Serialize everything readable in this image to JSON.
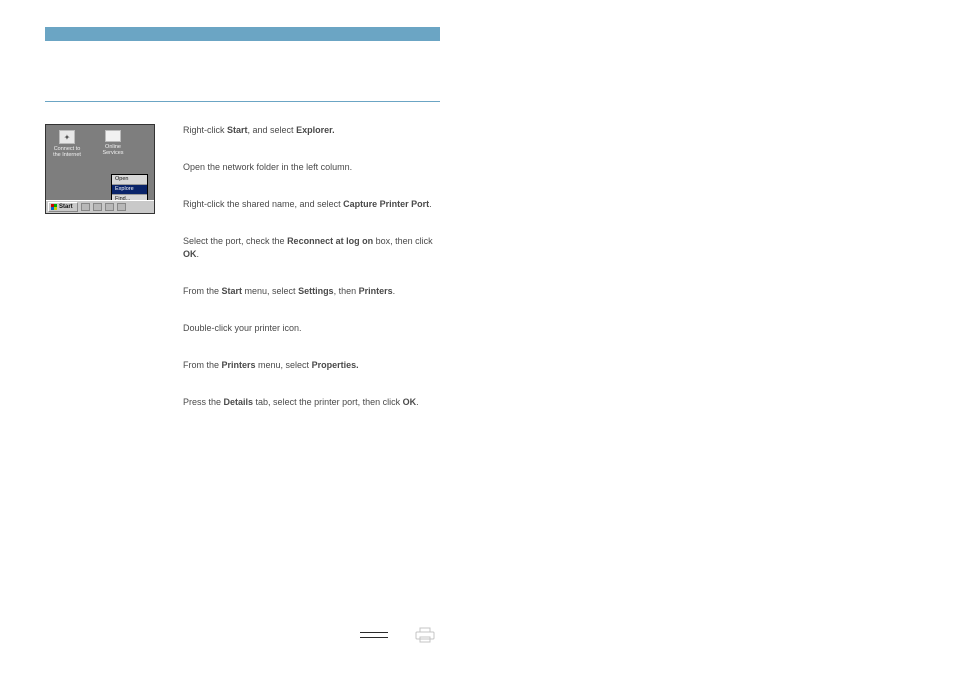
{
  "screenshot": {
    "icons": [
      {
        "name": "connect-internet",
        "label": "Connect to the\nInternet"
      },
      {
        "name": "online-services",
        "label": "Online\nServices"
      }
    ],
    "context_menu": [
      "Open",
      "Explore",
      "Find..."
    ],
    "start_label": "Start"
  },
  "steps": [
    {
      "parts": [
        {
          "t": "Right-click "
        },
        {
          "t": "Start",
          "b": true
        },
        {
          "t": ", and select "
        },
        {
          "t": "Explorer.",
          "b": true
        }
      ]
    },
    {
      "parts": [
        {
          "t": "Open the network folder in the left column."
        }
      ]
    },
    {
      "parts": [
        {
          "t": "Right-click the shared name, and select "
        },
        {
          "t": "Capture Printer Port",
          "b": true
        },
        {
          "t": "."
        }
      ]
    },
    {
      "parts": [
        {
          "t": "Select the port, check the "
        },
        {
          "t": "Reconnect at log on",
          "b": true
        },
        {
          "t": " box, then click "
        },
        {
          "t": "OK",
          "b": true
        },
        {
          "t": "."
        }
      ]
    },
    {
      "parts": [
        {
          "t": "From the "
        },
        {
          "t": "Start",
          "b": true
        },
        {
          "t": " menu, select "
        },
        {
          "t": "Settings",
          "b": true
        },
        {
          "t": ", then "
        },
        {
          "t": "Printers",
          "b": true
        },
        {
          "t": "."
        }
      ]
    },
    {
      "parts": [
        {
          "t": "Double-click your printer icon."
        }
      ]
    },
    {
      "parts": [
        {
          "t": "From the "
        },
        {
          "t": "Printers",
          "b": true
        },
        {
          "t": " menu, select "
        },
        {
          "t": "Properties.",
          "b": true
        }
      ]
    },
    {
      "parts": [
        {
          "t": "Press the "
        },
        {
          "t": "Details",
          "b": true
        },
        {
          "t": " tab, select the printer port, then click "
        },
        {
          "t": "OK",
          "b": true
        },
        {
          "t": "."
        }
      ]
    }
  ]
}
